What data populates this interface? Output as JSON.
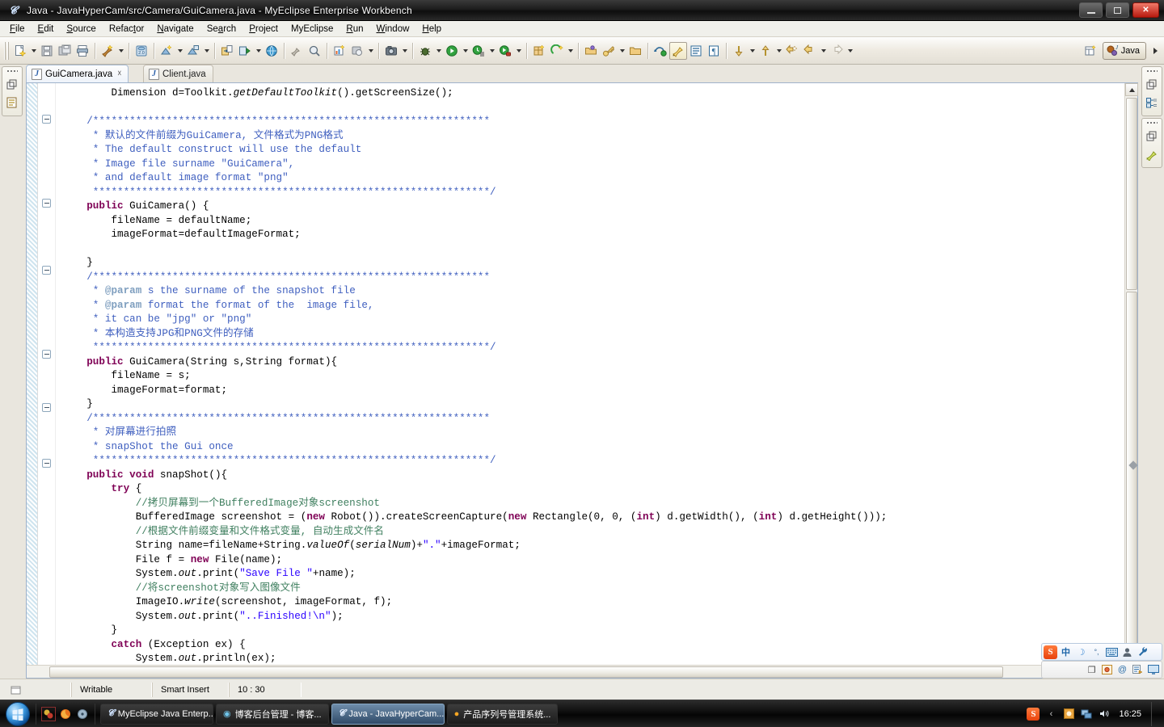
{
  "window": {
    "title": "Java - JavaHyperCam/src/Camera/GuiCamera.java - MyEclipse Enterprise Workbench",
    "app_icon": "java-icon",
    "controls": {
      "minimize": "–",
      "restore": "❐",
      "close": "✕"
    }
  },
  "menubar": {
    "items": [
      {
        "label": "File",
        "mnemonic": "F"
      },
      {
        "label": "Edit",
        "mnemonic": "E"
      },
      {
        "label": "Source",
        "mnemonic": "S"
      },
      {
        "label": "Refactor",
        "mnemonic": "t"
      },
      {
        "label": "Navigate",
        "mnemonic": "N"
      },
      {
        "label": "Search",
        "mnemonic": "a"
      },
      {
        "label": "Project",
        "mnemonic": "P"
      },
      {
        "label": "MyEclipse",
        "mnemonic": ""
      },
      {
        "label": "Run",
        "mnemonic": "R"
      },
      {
        "label": "Window",
        "mnemonic": "W"
      },
      {
        "label": "Help",
        "mnemonic": "H"
      }
    ]
  },
  "toolbar": {
    "groups": [
      {
        "buttons": [
          {
            "name": "new-wizard-icon",
            "arrow": true
          },
          {
            "name": "save-icon",
            "arrow": false
          },
          {
            "name": "save-all-icon",
            "arrow": false
          },
          {
            "name": "print-icon",
            "arrow": false
          }
        ]
      },
      {
        "buttons": [
          {
            "name": "myeclipse-quickstart-icon",
            "arrow": true
          }
        ]
      },
      {
        "buttons": [
          {
            "name": "database-explorer-icon",
            "arrow": false
          }
        ]
      },
      {
        "buttons": [
          {
            "name": "deploy-icon",
            "arrow": true
          },
          {
            "name": "server-icon",
            "arrow": true
          }
        ]
      },
      {
        "buttons": [
          {
            "name": "export-icon",
            "arrow": false
          },
          {
            "name": "run-server-icon",
            "arrow": true
          },
          {
            "name": "web-browser-icon",
            "arrow": false
          }
        ]
      },
      {
        "buttons": [
          {
            "name": "open-type-icon",
            "arrow": false
          },
          {
            "name": "search-icon",
            "arrow": false
          }
        ]
      },
      {
        "buttons": [
          {
            "name": "new-chart-icon",
            "arrow": false
          },
          {
            "name": "print-preview-icon",
            "arrow": true
          }
        ]
      },
      {
        "buttons": [
          {
            "name": "screenshot-icon",
            "arrow": true
          }
        ]
      },
      {
        "buttons": [
          {
            "name": "debug-icon",
            "arrow": true
          },
          {
            "name": "run-icon",
            "arrow": true
          },
          {
            "name": "run-history-icon",
            "arrow": true
          },
          {
            "name": "run-external-tools-icon",
            "arrow": true
          }
        ]
      },
      {
        "buttons": [
          {
            "name": "new-java-project-icon",
            "arrow": false
          },
          {
            "name": "new-annotation-icon",
            "arrow": true
          }
        ]
      },
      {
        "buttons": [
          {
            "name": "open-folder-icon",
            "arrow": false
          },
          {
            "name": "key-icon",
            "arrow": true
          },
          {
            "name": "closed-folder-icon",
            "arrow": false
          }
        ]
      },
      {
        "buttons": [
          {
            "name": "refresh-green-icon",
            "arrow": false
          },
          {
            "name": "toggle-mark-occurrences-icon",
            "arrow": false,
            "selected": true
          },
          {
            "name": "show-whitespace-icon",
            "arrow": false
          },
          {
            "name": "paragraph-marks-icon",
            "arrow": false
          }
        ]
      },
      {
        "buttons": [
          {
            "name": "next-annotation-icon",
            "arrow": true
          },
          {
            "name": "previous-annotation-icon",
            "arrow": true
          },
          {
            "name": "last-edit-location-icon",
            "arrow": false
          },
          {
            "name": "back-icon",
            "arrow": true
          },
          {
            "name": "forward-icon",
            "arrow": true
          }
        ]
      }
    ],
    "perspective": {
      "open_perspective_icon": "open-perspective-icon",
      "current": "Java",
      "current_icon": "java-perspective-icon"
    },
    "overflow_icon": "toolbar-overflow-icon"
  },
  "fast_views": {
    "left": [
      {
        "stack": [
          "restore-icon",
          "package-explorer-icon"
        ]
      }
    ],
    "right": [
      {
        "stack": [
          "restore-icon",
          "outline-icon"
        ]
      },
      {
        "stack": [
          "restore-icon",
          "task-list-icon"
        ]
      }
    ]
  },
  "editor": {
    "tabs": [
      {
        "label": "GuiCamera.java",
        "icon": "java-file-icon",
        "active": true,
        "closable": true,
        "close_glyph": "✂"
      },
      {
        "label": "Client.java",
        "icon": "java-file-icon",
        "active": false,
        "closable": false
      }
    ],
    "fold_markers_lines": [
      2,
      10,
      18,
      25,
      29
    ],
    "code_lines": [
      {
        "indent": 2,
        "segments": [
          {
            "t": "Dimension d=Toolkit.",
            "c": ""
          },
          {
            "t": "getDefaultToolkit",
            "c": "it"
          },
          {
            "t": "().getScreenSize();",
            "c": ""
          }
        ]
      },
      {
        "indent": 0,
        "segments": []
      },
      {
        "indent": 1,
        "segments": [
          {
            "t": "/*****************************************************************",
            "c": "jd"
          }
        ]
      },
      {
        "indent": 1,
        "segments": [
          {
            "t": " * 默认的文件前缀为GuiCamera, 文件格式为PNG格式",
            "c": "jd"
          }
        ]
      },
      {
        "indent": 1,
        "segments": [
          {
            "t": " * The default construct will use the default",
            "c": "jd"
          }
        ]
      },
      {
        "indent": 1,
        "segments": [
          {
            "t": " * Image file surname \"GuiCamera\",",
            "c": "jd"
          }
        ]
      },
      {
        "indent": 1,
        "segments": [
          {
            "t": " * and default image format \"png\"",
            "c": "jd"
          }
        ]
      },
      {
        "indent": 1,
        "segments": [
          {
            "t": " *****************************************************************/",
            "c": "jd"
          }
        ]
      },
      {
        "indent": 1,
        "segments": [
          {
            "t": "public",
            "c": "kw"
          },
          {
            "t": " GuiCamera() {",
            "c": ""
          }
        ]
      },
      {
        "indent": 2,
        "segments": [
          {
            "t": "fileName = defaultName;",
            "c": ""
          }
        ]
      },
      {
        "indent": 2,
        "segments": [
          {
            "t": "imageFormat=defaultImageFormat;",
            "c": ""
          }
        ]
      },
      {
        "indent": 0,
        "segments": []
      },
      {
        "indent": 1,
        "segments": [
          {
            "t": "}",
            "c": ""
          }
        ]
      },
      {
        "indent": 1,
        "segments": [
          {
            "t": "/*****************************************************************",
            "c": "jd"
          }
        ]
      },
      {
        "indent": 1,
        "segments": [
          {
            "t": " * ",
            "c": "jd"
          },
          {
            "t": "@param",
            "c": "jdtag"
          },
          {
            "t": " s the surname of the snapshot file",
            "c": "jd"
          }
        ]
      },
      {
        "indent": 1,
        "segments": [
          {
            "t": " * ",
            "c": "jd"
          },
          {
            "t": "@param",
            "c": "jdtag"
          },
          {
            "t": " format the format of the  image file,",
            "c": "jd"
          }
        ]
      },
      {
        "indent": 1,
        "segments": [
          {
            "t": " * it can be \"jpg\" or \"png\"",
            "c": "jd"
          }
        ]
      },
      {
        "indent": 1,
        "segments": [
          {
            "t": " * 本构造支持JPG和PNG文件的存储",
            "c": "jd"
          }
        ]
      },
      {
        "indent": 1,
        "segments": [
          {
            "t": " *****************************************************************/",
            "c": "jd"
          }
        ]
      },
      {
        "indent": 1,
        "segments": [
          {
            "t": "public",
            "c": "kw"
          },
          {
            "t": " GuiCamera(String s,String format){",
            "c": ""
          }
        ]
      },
      {
        "indent": 2,
        "segments": [
          {
            "t": "fileName = s;",
            "c": ""
          }
        ]
      },
      {
        "indent": 2,
        "segments": [
          {
            "t": "imageFormat=format;",
            "c": ""
          }
        ]
      },
      {
        "indent": 1,
        "segments": [
          {
            "t": "}",
            "c": ""
          }
        ]
      },
      {
        "indent": 1,
        "segments": [
          {
            "t": "/*****************************************************************",
            "c": "jd"
          }
        ]
      },
      {
        "indent": 1,
        "segments": [
          {
            "t": " * 对屏幕进行拍照",
            "c": "jd"
          }
        ]
      },
      {
        "indent": 1,
        "segments": [
          {
            "t": " * snapShot the Gui once",
            "c": "jd"
          }
        ]
      },
      {
        "indent": 1,
        "segments": [
          {
            "t": " *****************************************************************/",
            "c": "jd"
          }
        ]
      },
      {
        "indent": 1,
        "segments": [
          {
            "t": "public",
            "c": "kw"
          },
          {
            "t": " ",
            "c": ""
          },
          {
            "t": "void",
            "c": "kw"
          },
          {
            "t": " snapShot(){",
            "c": ""
          }
        ]
      },
      {
        "indent": 2,
        "segments": [
          {
            "t": "try",
            "c": "kw"
          },
          {
            "t": " {",
            "c": ""
          }
        ]
      },
      {
        "indent": 3,
        "segments": [
          {
            "t": "//拷贝屏幕到一个BufferedImage对象screenshot",
            "c": "cm"
          }
        ]
      },
      {
        "indent": 3,
        "segments": [
          {
            "t": "BufferedImage screenshot = (",
            "c": ""
          },
          {
            "t": "new",
            "c": "kw"
          },
          {
            "t": " Robot()).createScreenCapture(",
            "c": ""
          },
          {
            "t": "new",
            "c": "kw"
          },
          {
            "t": " Rectangle(0, 0, (",
            "c": ""
          },
          {
            "t": "int",
            "c": "kw"
          },
          {
            "t": ") d.getWidth(), (",
            "c": ""
          },
          {
            "t": "int",
            "c": "kw"
          },
          {
            "t": ") d.getHeight()));",
            "c": ""
          }
        ]
      },
      {
        "indent": 3,
        "segments": [
          {
            "t": "//根据文件前缀变量和文件格式变量, 自动生成文件名",
            "c": "cm"
          }
        ]
      },
      {
        "indent": 3,
        "segments": [
          {
            "t": "String name=fileName+String.",
            "c": ""
          },
          {
            "t": "valueOf",
            "c": "it"
          },
          {
            "t": "(",
            "c": ""
          },
          {
            "t": "serialNum",
            "c": "it"
          },
          {
            "t": ")+",
            "c": ""
          },
          {
            "t": "\".\"",
            "c": "st"
          },
          {
            "t": "+imageFormat;",
            "c": ""
          }
        ]
      },
      {
        "indent": 3,
        "segments": [
          {
            "t": "File f = ",
            "c": ""
          },
          {
            "t": "new",
            "c": "kw"
          },
          {
            "t": " File(name);",
            "c": ""
          }
        ]
      },
      {
        "indent": 3,
        "segments": [
          {
            "t": "System.",
            "c": ""
          },
          {
            "t": "out",
            "c": "it"
          },
          {
            "t": ".print(",
            "c": ""
          },
          {
            "t": "\"Save File \"",
            "c": "st"
          },
          {
            "t": "+name);",
            "c": ""
          }
        ]
      },
      {
        "indent": 3,
        "segments": [
          {
            "t": "//将screenshot对象写入图像文件",
            "c": "cm"
          }
        ]
      },
      {
        "indent": 3,
        "segments": [
          {
            "t": "ImageIO.",
            "c": ""
          },
          {
            "t": "write",
            "c": "it"
          },
          {
            "t": "(screenshot, imageFormat, f);",
            "c": ""
          }
        ]
      },
      {
        "indent": 3,
        "segments": [
          {
            "t": "System.",
            "c": ""
          },
          {
            "t": "out",
            "c": "it"
          },
          {
            "t": ".print(",
            "c": ""
          },
          {
            "t": "\"..Finished!\\n\"",
            "c": "st"
          },
          {
            "t": ");",
            "c": ""
          }
        ]
      },
      {
        "indent": 2,
        "segments": [
          {
            "t": "}",
            "c": ""
          }
        ]
      },
      {
        "indent": 2,
        "segments": [
          {
            "t": "catch",
            "c": "kw"
          },
          {
            "t": " (Exception ex) {",
            "c": ""
          }
        ]
      },
      {
        "indent": 3,
        "segments": [
          {
            "t": "System.",
            "c": ""
          },
          {
            "t": "out",
            "c": "it"
          },
          {
            "t": ".println(ex);",
            "c": ""
          }
        ]
      },
      {
        "indent": 2,
        "segments": [
          {
            "t": "}",
            "c": ""
          }
        ]
      }
    ]
  },
  "statusbar": {
    "cells": [
      "",
      "Writable",
      "Smart Insert",
      "10 : 30"
    ]
  },
  "ime": {
    "row1": [
      {
        "name": "sogou-logo-icon",
        "glyph": "S"
      },
      {
        "name": "chinese-mode-icon",
        "glyph": "中"
      },
      {
        "name": "half-width-icon",
        "glyph": "☽"
      },
      {
        "name": "punctuation-icon",
        "glyph": "°,"
      },
      {
        "name": "soft-keyboard-icon",
        "glyph": "⌨"
      },
      {
        "name": "user-icon",
        "glyph": "👤"
      },
      {
        "name": "settings-wrench-icon",
        "glyph": "🔧"
      }
    ],
    "row2": [
      {
        "name": "window-restore-icon",
        "glyph": "❐"
      },
      {
        "name": "screenshot-tool-icon",
        "glyph": "▣"
      },
      {
        "name": "at-icon",
        "glyph": "@"
      },
      {
        "name": "translate-icon",
        "glyph": "▤"
      },
      {
        "name": "monitor-icon",
        "glyph": "🖵"
      }
    ]
  },
  "taskbar": {
    "start_icon": "windows-start-orb",
    "quicklaunch": [
      {
        "name": "quicklaunch-app-icon",
        "glyph": "▣"
      },
      {
        "name": "firefox-icon",
        "glyph": "◉"
      },
      {
        "name": "media-icon",
        "glyph": "◎"
      }
    ],
    "tasks": [
      {
        "label": "MyEclipse Java Enterp...",
        "icon": "java-icon",
        "active": false
      },
      {
        "label": "博客后台管理 - 博客...",
        "icon": "browser-icon",
        "active": false
      },
      {
        "label": "Java - JavaHyperCam...",
        "icon": "java-icon",
        "active": true
      },
      {
        "label": "产品序列号管理系统...",
        "icon": "firefox-icon",
        "active": false
      }
    ],
    "tray": [
      {
        "name": "sogou-tray-icon",
        "glyph": "S"
      },
      {
        "name": "tray-expand-icon",
        "glyph": "‹"
      },
      {
        "name": "tray-app-icon",
        "glyph": "▤"
      },
      {
        "name": "network-icon",
        "glyph": "▦"
      },
      {
        "name": "volume-icon",
        "glyph": "🔊"
      }
    ],
    "clock": "16:25"
  },
  "colors": {
    "accent": "#2a00ff",
    "keyword": "#7f0055",
    "comment": "#3f7f5f",
    "javadoc": "#3f5fbf",
    "titlebar": "#0d0d0d",
    "toolbar_bg": "#eeeae1"
  }
}
